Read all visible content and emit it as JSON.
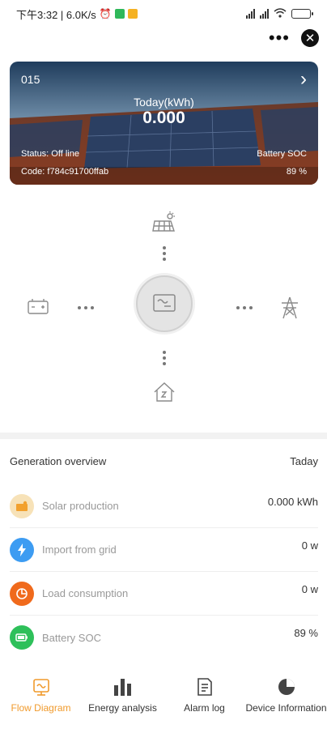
{
  "status_bar": {
    "time_speed": "下午3:32 | 6.0K/s",
    "battery_level": 0.75,
    "colors": {
      "wechat": "#2fb85a",
      "app": "#f5b223"
    }
  },
  "top_actions": {
    "more_icon": "more-dots-icon",
    "close_icon": "close-icon",
    "more_label": "•••",
    "close_label": "✕"
  },
  "hero": {
    "plant_id": "015",
    "today_label": "Today(kWh)",
    "today_value": "0.000",
    "status": "Status: Off line",
    "code": "Code: f784c91700ffab",
    "battery_soc_label": "Battery SOC",
    "battery_soc_value": "89 %"
  },
  "flow": {
    "nodes": [
      "solar-panel-icon",
      "battery-icon",
      "inverter-icon",
      "grid-tower-icon",
      "home-load-icon"
    ]
  },
  "overview": {
    "title": "Generation overview",
    "period": "Taday",
    "rows": [
      {
        "label": "Solar production",
        "value": "0.000 kWh",
        "color": "#f7e2b8",
        "icon": "solar-icon"
      },
      {
        "label": "Import from grid",
        "value": "0 w",
        "color": "#3d9cf2",
        "icon": "lightning-icon"
      },
      {
        "label": "Load consumption",
        "value": "0 w",
        "color": "#f06a1c",
        "icon": "pie-clock-icon"
      },
      {
        "label": "Battery SOC",
        "value": "89 %",
        "color": "#2ec05a",
        "icon": "battery-icon"
      }
    ]
  },
  "nav": {
    "items": [
      {
        "label": "Flow Diagram",
        "icon": "flow-diagram-icon",
        "active": true
      },
      {
        "label": "Energy analysis",
        "icon": "bar-chart-icon",
        "active": false
      },
      {
        "label": "Alarm log",
        "icon": "document-icon",
        "active": false
      },
      {
        "label": "Device Information",
        "icon": "pie-chart-icon",
        "active": false
      }
    ],
    "colors": {
      "active": "#f09a2c",
      "inactive": "#444444"
    }
  }
}
